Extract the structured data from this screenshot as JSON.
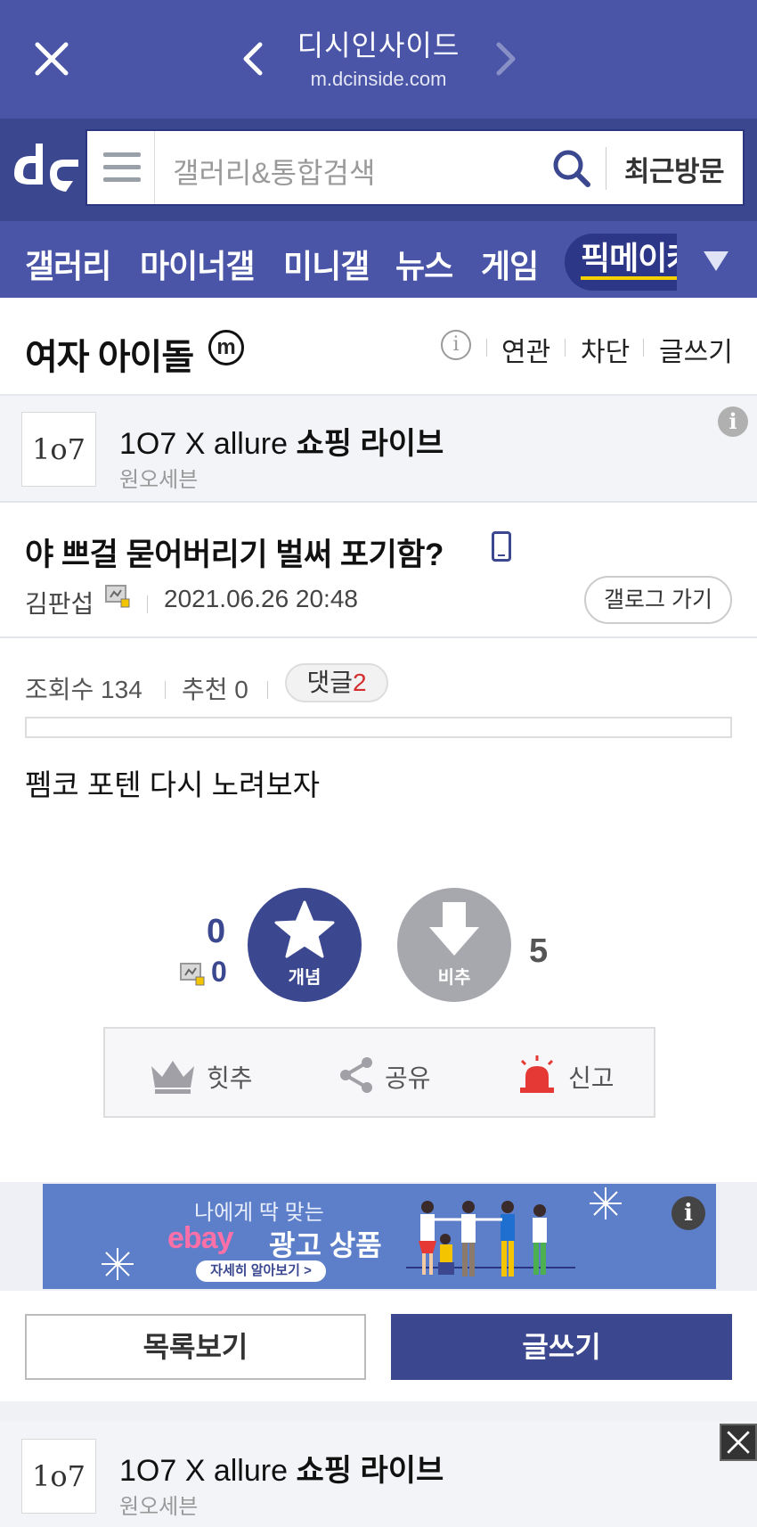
{
  "browser": {
    "title": "디시인사이드",
    "url": "m.dcinside.com"
  },
  "search": {
    "placeholder": "갤러리&통합검색",
    "recent_label": "최근방문"
  },
  "nav": {
    "items": [
      "갤러리",
      "마이너갤",
      "미니갤",
      "뉴스",
      "게임"
    ],
    "active": "픽메이커"
  },
  "gallery": {
    "name": "여자 아이돌",
    "badge": "m",
    "info": "i",
    "links": [
      "연관",
      "차단",
      "글쓰기"
    ]
  },
  "ad_top": {
    "logo": "1o7",
    "title_plain": "1O7 X allure ",
    "title_bold": "쇼핑 라이브",
    "subtitle": "원오세븐",
    "info": "i"
  },
  "post": {
    "title": "야 쁘걸 묻어버리기 벌써 포기함?",
    "author": "김판섭",
    "date": "2021.06.26 20:48",
    "gallog_button": "갤로그 가기",
    "views_label": "조회수 134",
    "recommend_label": "추천 0",
    "comment_label": "댓글",
    "comment_count": "2",
    "body": "펨코 포텐 다시 노려보자"
  },
  "votes": {
    "up_count": "0",
    "fixed_count": "0",
    "up_label": "개념",
    "down_label": "비추",
    "down_count": "5"
  },
  "actions": {
    "hit": "힛추",
    "share": "공유",
    "report": "신고"
  },
  "banner": {
    "line1": "나에게 딱 맞는",
    "brand": "ebay",
    "headline": "광고 상품",
    "cta": "자세히 알아보기 >",
    "info": "i"
  },
  "buttons": {
    "list": "목록보기",
    "write": "글쓰기"
  },
  "ad_bottom": {
    "logo": "1o7",
    "title_plain": "1O7 X allure ",
    "title_bold": "쇼핑 라이브",
    "subtitle": "원오세븐"
  },
  "colors": {
    "brand_dark": "#3b4890",
    "brand": "#4a55a7",
    "accent_yellow": "#f5d100",
    "report_red": "#e53935"
  }
}
